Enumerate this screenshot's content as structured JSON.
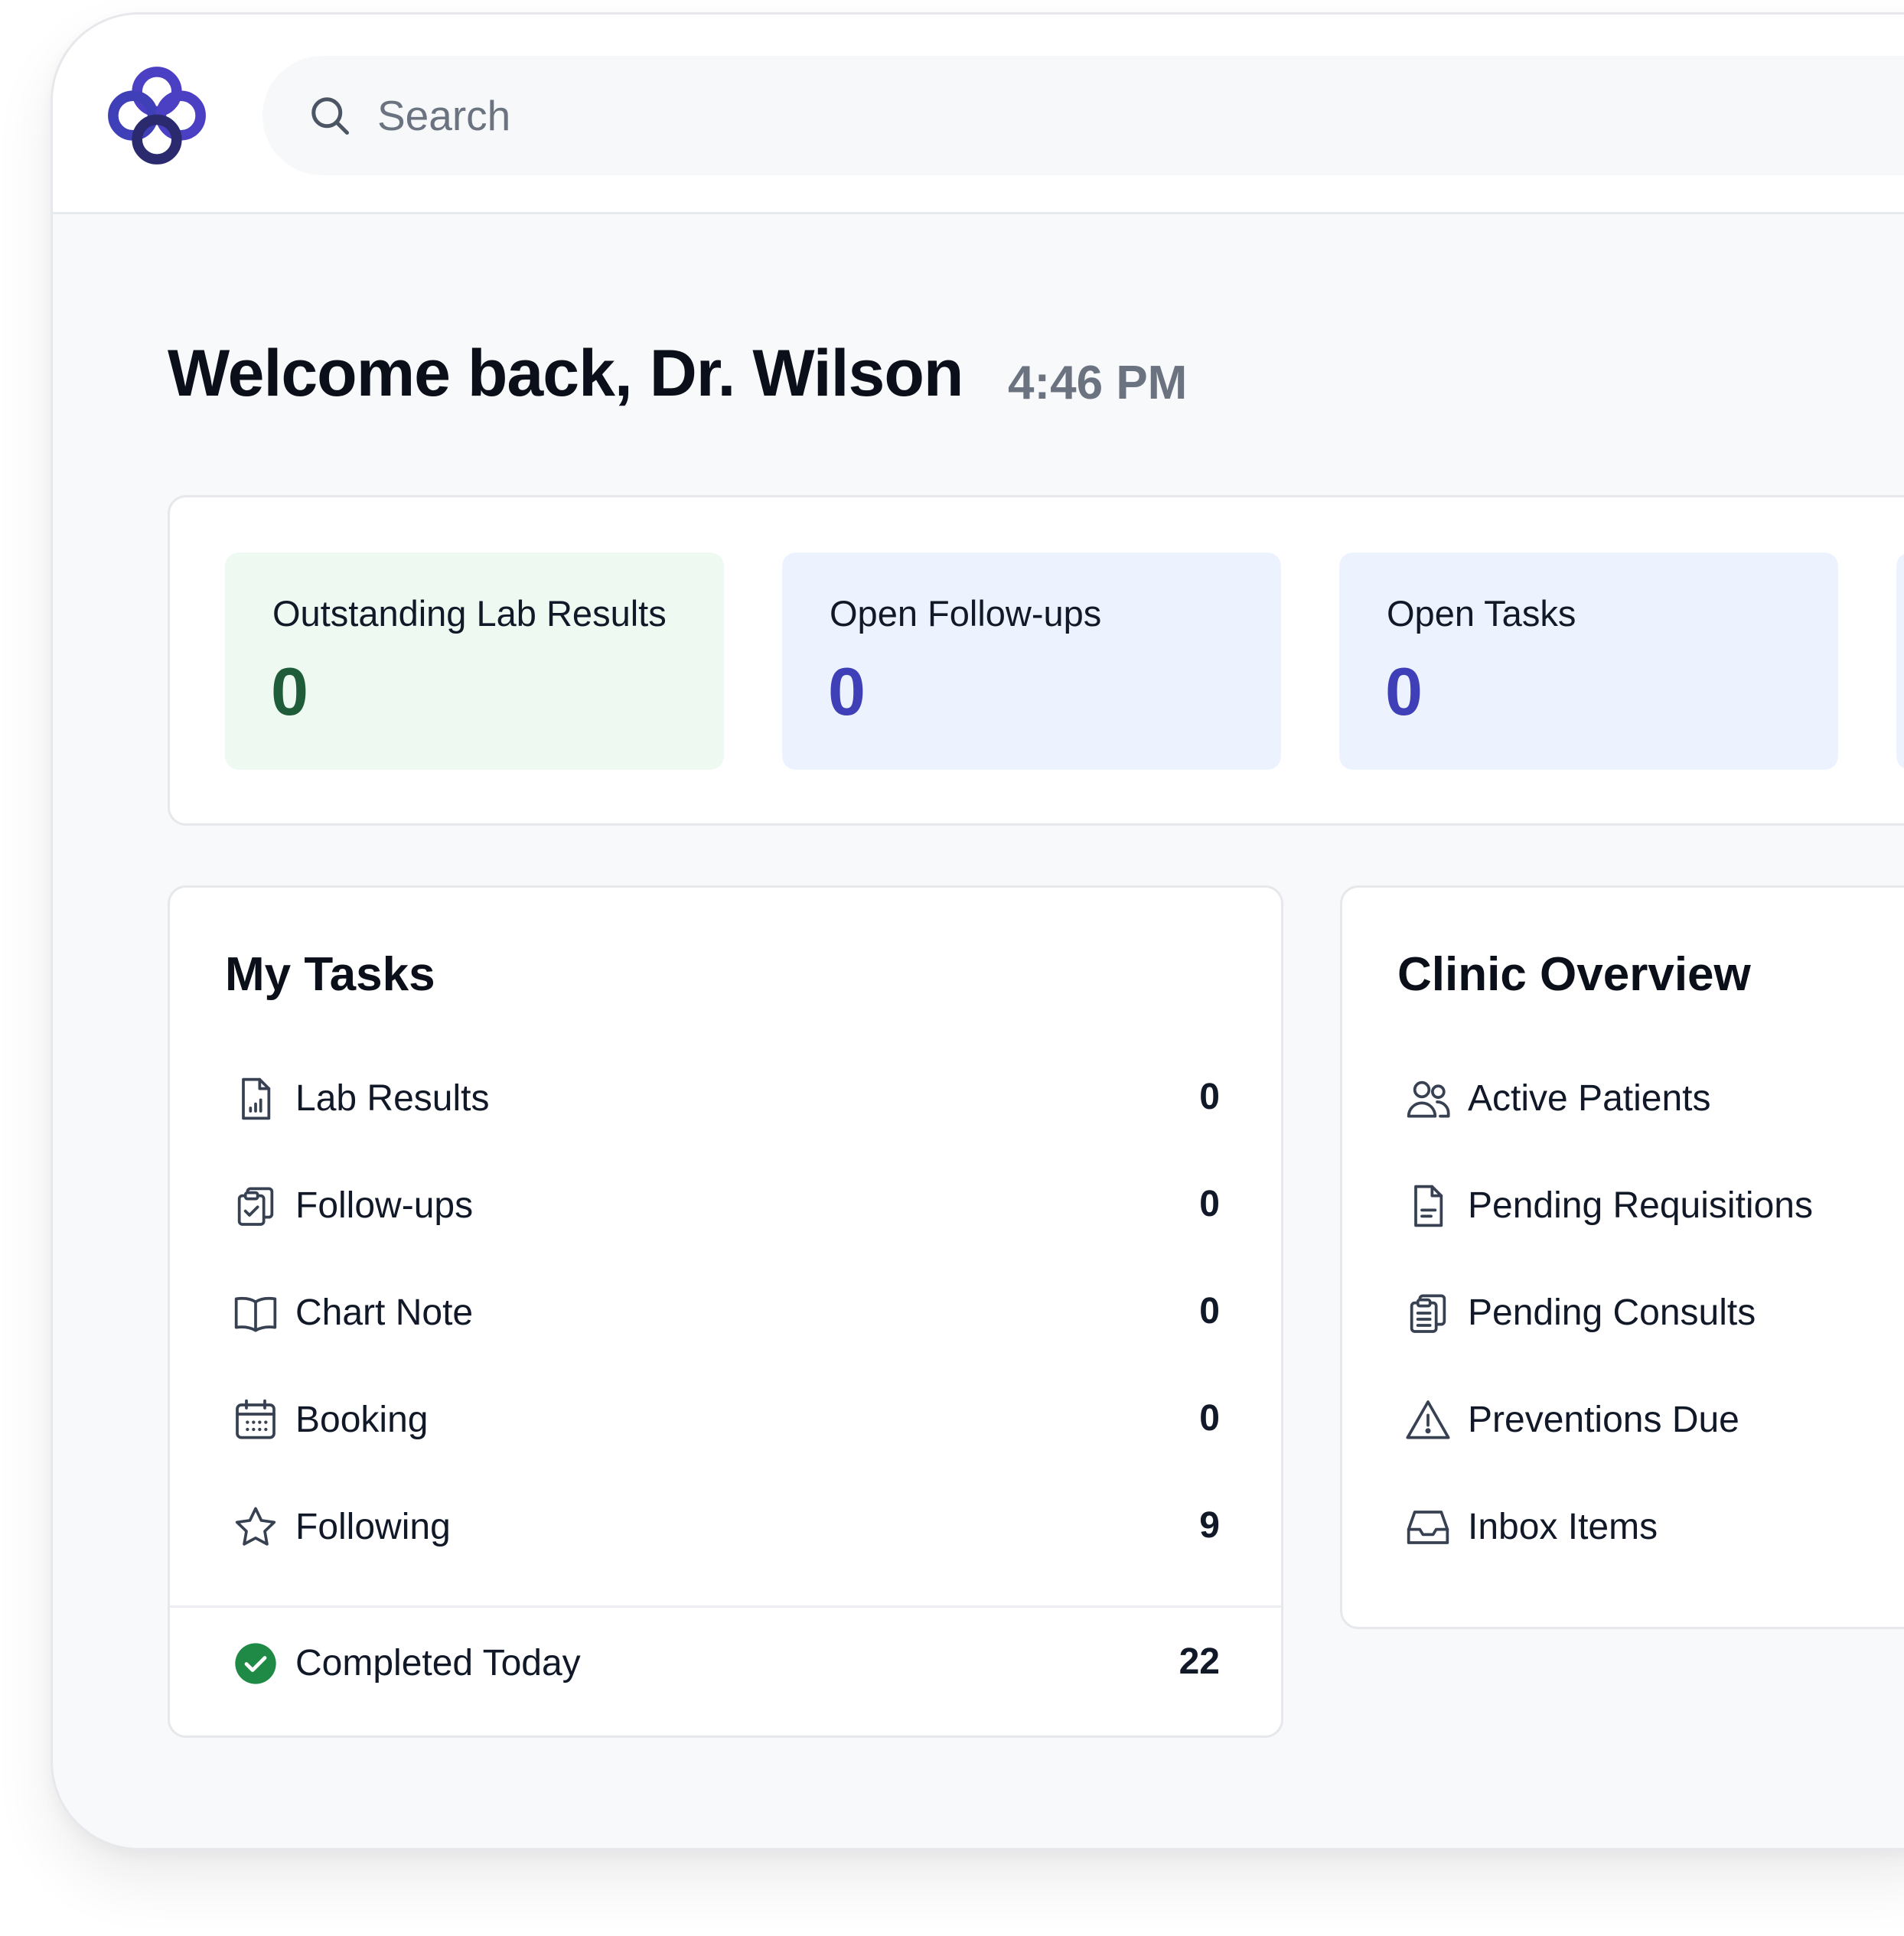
{
  "colors": {
    "brand": "#3f3fb8",
    "green_value": "#1f5d3a",
    "green_card": "#edf9f1",
    "blue_card": "#ecf2fe",
    "success": "#1e8a45"
  },
  "search": {
    "placeholder": "Search",
    "icon": "search-icon"
  },
  "header": {
    "welcome": "Welcome back, Dr. Wilson",
    "time": "4:46 PM"
  },
  "stats": [
    {
      "label": "Outstanding Lab Results",
      "value": "0"
    },
    {
      "label": "Open Follow-ups",
      "value": "0"
    },
    {
      "label": "Open Tasks",
      "value": "0"
    }
  ],
  "my_tasks": {
    "title": "My Tasks",
    "items": [
      {
        "label": "Lab Results",
        "count": "0",
        "icon": "lab-report-icon"
      },
      {
        "label": "Follow-ups",
        "count": "0",
        "icon": "clipboard-check-icon"
      },
      {
        "label": "Chart Note",
        "count": "0",
        "icon": "book-open-icon"
      },
      {
        "label": "Booking",
        "count": "0",
        "icon": "calendar-icon"
      },
      {
        "label": "Following",
        "count": "9",
        "icon": "star-icon"
      }
    ],
    "completed": {
      "label": "Completed Today",
      "count": "22",
      "icon": "check-circle-icon"
    }
  },
  "clinic_overview": {
    "title": "Clinic Overview",
    "items": [
      {
        "label": "Active Patients",
        "icon": "users-icon"
      },
      {
        "label": "Pending Requisitions",
        "icon": "document-icon"
      },
      {
        "label": "Pending Consults",
        "icon": "clipboard-list-icon"
      },
      {
        "label": "Preventions Due",
        "icon": "warning-icon"
      },
      {
        "label": "Inbox Items",
        "icon": "inbox-icon"
      }
    ]
  }
}
